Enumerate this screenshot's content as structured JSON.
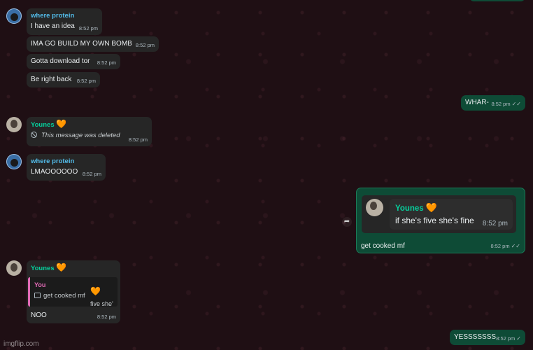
{
  "messages": {
    "m1": {
      "sender": "where protein",
      "text": "I have an idea",
      "time": "8:52 pm"
    },
    "m2": {
      "text": "IMA GO BUILD MY OWN BOMB",
      "time": "8:52 pm"
    },
    "m3": {
      "text": "Gotta download tor",
      "time": "8:52 pm"
    },
    "m4": {
      "text": "Be right back",
      "time": "8:52 pm"
    },
    "m5": {
      "text": "WHAR-",
      "time": "8:52 pm",
      "status": "read"
    },
    "m6": {
      "sender": "Younes",
      "text": "This message was deleted",
      "time": "8:52 pm"
    },
    "m7": {
      "sender": "where protein",
      "text": "LMAOOOOOO",
      "time": "8:52 pm"
    },
    "m8": {
      "quote": {
        "sender": "Younes",
        "text": "if she's five she's fine",
        "time": "8:52 pm"
      },
      "text": "get cooked mf",
      "time": "8:52 pm",
      "status": "read"
    },
    "m9": {
      "sender": "Younes",
      "reply": {
        "author": "You",
        "text": "get cooked mf",
        "overflow": "five she'"
      },
      "text": "NOO",
      "time": "8:52 pm"
    },
    "m10": {
      "text": "YESSSSSSS",
      "time": "8:52 pm",
      "status": "delivered"
    }
  },
  "icons": {
    "heart": "🧡",
    "double_check": "✓✓",
    "single_check": "✓",
    "forward": "➦"
  },
  "watermark": "imgflip.com",
  "colors": {
    "background": "#1f0f14",
    "incoming_bubble": "#262626",
    "outgoing_bubble": "#0e4b36",
    "sender_blue": "#53bdeb",
    "sender_green": "#06cf9c",
    "reply_accent": "#e26ab6"
  }
}
